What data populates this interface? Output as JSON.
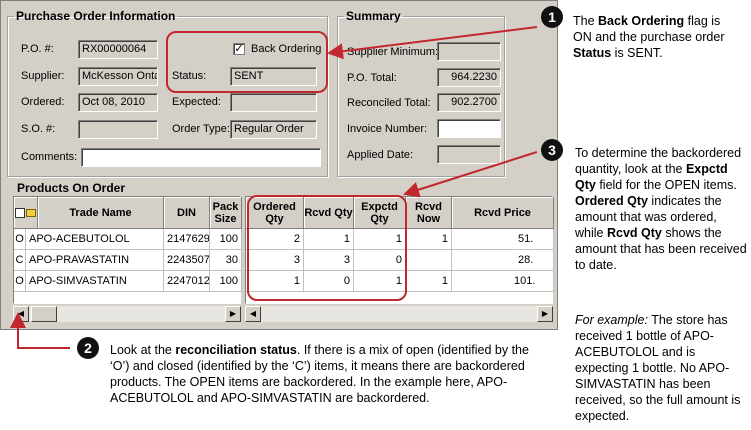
{
  "po_info": {
    "title": "Purchase Order Information",
    "po_label": "P.O. #:",
    "po_value": "RX00000064",
    "back_ordering_label": "Back Ordering",
    "back_ordering_checked": "✓",
    "supplier_label": "Supplier:",
    "supplier_value": "McKesson Onta",
    "status_label": "Status:",
    "status_value": "SENT",
    "ordered_label": "Ordered:",
    "ordered_value": "Oct 08, 2010",
    "expected_label": "Expected:",
    "expected_value": "",
    "so_label": "S.O. #:",
    "so_value": "",
    "order_type_label": "Order Type:",
    "order_type_value": "Regular Order",
    "comments_label": "Comments:",
    "comments_value": ""
  },
  "summary": {
    "title": "Summary",
    "supplier_min_label": "Supplier Minimum:",
    "supplier_min_value": "",
    "po_total_label": "P.O. Total:",
    "po_total_value": "964.2230",
    "reconciled_total_label": "Reconciled Total:",
    "reconciled_total_value": "902.2700",
    "invoice_number_label": "Invoice Number:",
    "invoice_number_value": "",
    "applied_date_label": "Applied Date:",
    "applied_date_value": ""
  },
  "products": {
    "title": "Products On Order",
    "left_columns": [
      "Trade Name",
      "DIN",
      "Pack Size"
    ],
    "right_columns": [
      "Ordered Qty",
      "Rcvd Qty",
      "Expctd Qty",
      "Rcvd Now",
      "Rcvd Price"
    ],
    "rows": [
      {
        "status": "O",
        "trade_name": "APO-ACEBUTOLOL",
        "din": "2147629",
        "pack": "100",
        "ordered": "2",
        "rcvd": "1",
        "expctd": "1",
        "rcvd_now": "1",
        "price": "51."
      },
      {
        "status": "C",
        "trade_name": "APO-PRAVASTATIN",
        "din": "2243507",
        "pack": "30",
        "ordered": "3",
        "rcvd": "3",
        "expctd": "0",
        "rcvd_now": "",
        "price": "28."
      },
      {
        "status": "O",
        "trade_name": "APO-SIMVASTATIN",
        "din": "2247012",
        "pack": "100",
        "ordered": "1",
        "rcvd": "0",
        "expctd": "1",
        "rcvd_now": "1",
        "price": "101."
      }
    ]
  },
  "annotations": {
    "n1": {
      "badge": "1",
      "p1": "The ",
      "b1": "Back Ordering",
      "p2": " flag is ON and the purchase order ",
      "b2": "Status",
      "p3": " is SENT."
    },
    "n2": {
      "badge": "2",
      "p1": "Look at the ",
      "b1": "reconciliation status",
      "p2": ".  If there is a mix of open (identified by the ‘O’) and closed (identified by the ‘C’) items, it means there are backordered products.  The OPEN items are backordered.  In the example here, APO-ACEBUTOLOL  and APO-SIMVASTATIN  are backordered."
    },
    "n3": {
      "badge": "3",
      "p1": "To determine the backordered quantity, look at the ",
      "b1": "Expctd Qty",
      "p2": " field for the OPEN items.  ",
      "b2": "Ordered Qty",
      "p3": " indicates the amount that was ordered, while ",
      "b3": "Rcvd Qty",
      "p4": " shows the amount that has been received to date."
    },
    "n4": {
      "i1": "For example:",
      "p1": " The store has received 1 bottle of APO-ACEBUTOLOL  and is expecting 1 bottle.  No APO-SIMVASTATIN  has been received, so the full amount is expected."
    }
  },
  "colors": {
    "highlight": "#c0282e",
    "window_bg": "#d4d0c8"
  }
}
